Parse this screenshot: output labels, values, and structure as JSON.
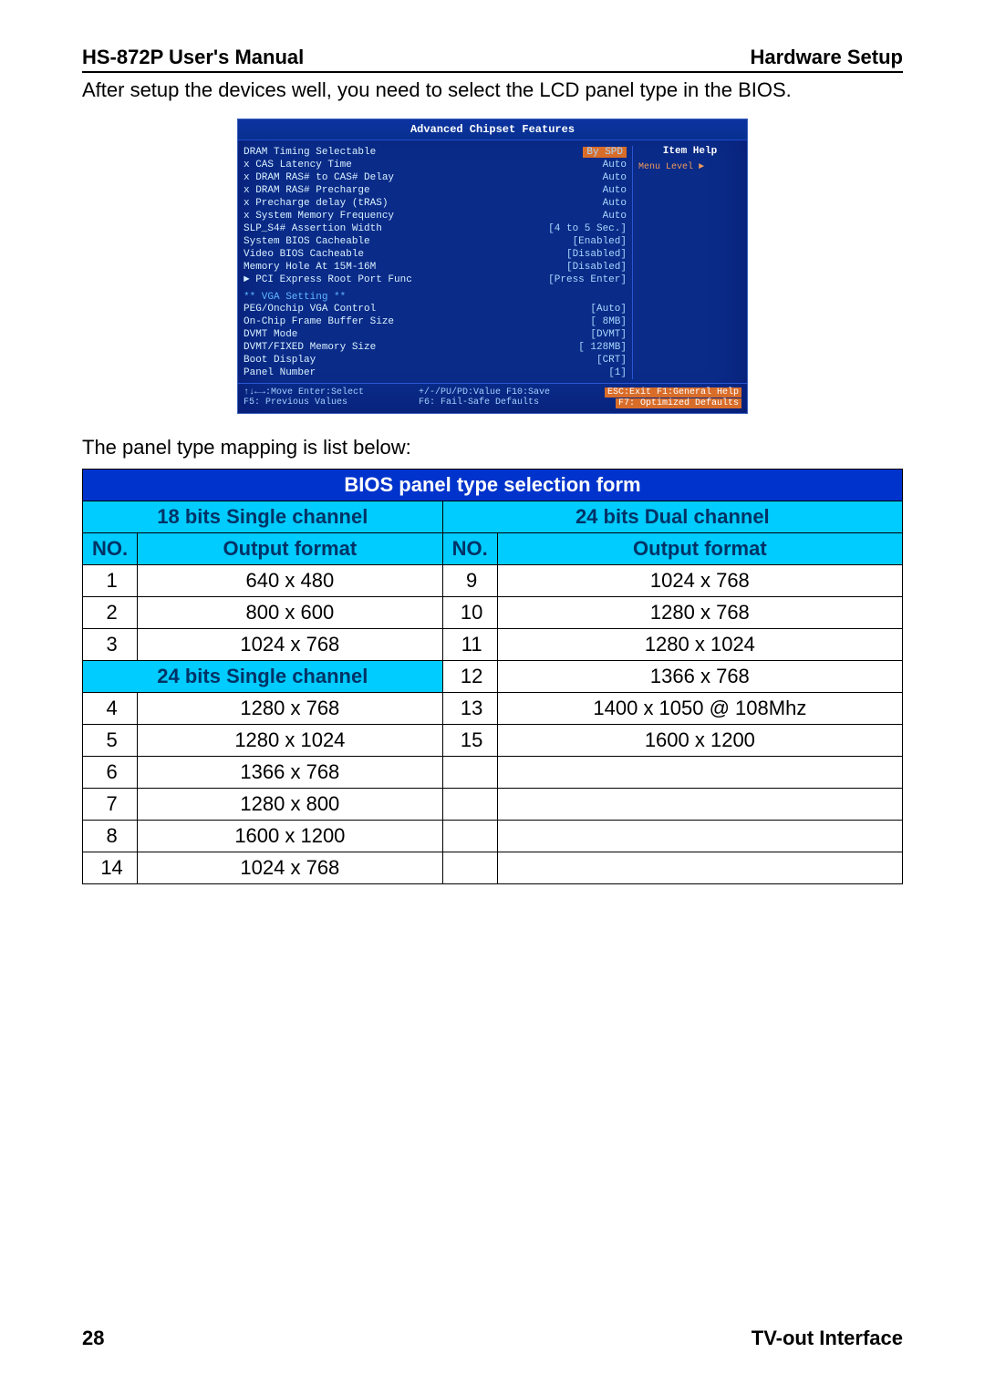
{
  "header": {
    "left": "HS-872P User's Manual",
    "right": "Hardware Setup"
  },
  "intro": "After setup the devices well, you need to select the LCD panel type in the BIOS.",
  "bios": {
    "title": "Advanced Chipset Features",
    "rows": [
      {
        "lbl": "DRAM Timing Selectable",
        "val": "By SPD",
        "hl": true
      },
      {
        "lbl": "x CAS Latency Time",
        "val": "Auto",
        "dim": true
      },
      {
        "lbl": "x DRAM RAS# to CAS# Delay",
        "val": "Auto",
        "dim": true
      },
      {
        "lbl": "x DRAM RAS# Precharge",
        "val": "Auto",
        "dim": true
      },
      {
        "lbl": "x Precharge delay (tRAS)",
        "val": "Auto",
        "dim": true
      },
      {
        "lbl": "x System Memory Frequency",
        "val": "Auto",
        "dim": true
      },
      {
        "lbl": "SLP_S4# Assertion Width",
        "val": "[4 to 5 Sec.]"
      },
      {
        "lbl": "System BIOS Cacheable",
        "val": "[Enabled]"
      },
      {
        "lbl": "Video BIOS Cacheable",
        "val": "[Disabled]"
      },
      {
        "lbl": "Memory Hole At 15M-16M",
        "val": "[Disabled]"
      },
      {
        "lbl": "► PCI Express Root Port Func",
        "val": "[Press Enter]"
      }
    ],
    "sectionHeading": "** VGA Setting **",
    "rows2": [
      {
        "lbl": "PEG/Onchip VGA Control",
        "val": "[Auto]"
      },
      {
        "lbl": "On-Chip Frame Buffer Size",
        "val": "[ 8MB]"
      },
      {
        "lbl": "DVMT Mode",
        "val": "[DVMT]"
      },
      {
        "lbl": "DVMT/FIXED Memory Size",
        "val": "[ 128MB]"
      },
      {
        "lbl": "Boot Display",
        "val": "[CRT]"
      },
      {
        "lbl": "Panel Number",
        "val": "[1]"
      }
    ],
    "help": {
      "title": "Item Help",
      "sub": "Menu Level  ►"
    },
    "footer": {
      "left1": "↑↓←→:Move  Enter:Select",
      "left2": "F5: Previous Values",
      "mid1": "+/-/PU/PD:Value  F10:Save",
      "mid2": "F6: Fail-Safe Defaults",
      "r1": "ESC:Exit  F1:General Help",
      "r2": "F7: Optimized Defaults"
    }
  },
  "caption": "The panel type mapping is list below:",
  "table": {
    "title": "BIOS panel type selection form",
    "h_left": "18 bits Single channel",
    "h_right": "24 bits Dual channel",
    "sub_no": "NO.",
    "sub_fmt": "Output format",
    "left_section2": "24 bits Single channel",
    "left": [
      {
        "no": "1",
        "fmt": "640 x 480"
      },
      {
        "no": "2",
        "fmt": "800 x 600"
      },
      {
        "no": "3",
        "fmt": "1024 x 768"
      }
    ],
    "left2": [
      {
        "no": "4",
        "fmt": "1280 x 768"
      },
      {
        "no": "5",
        "fmt": "1280 x 1024"
      },
      {
        "no": "6",
        "fmt": "1366 x 768"
      },
      {
        "no": "7",
        "fmt": "1280 x 800"
      },
      {
        "no": "8",
        "fmt": "1600 x 1200"
      },
      {
        "no": "14",
        "fmt": "1024 x 768"
      }
    ],
    "right": [
      {
        "no": "9",
        "fmt": "1024 x 768"
      },
      {
        "no": "10",
        "fmt": "1280 x 768"
      },
      {
        "no": "11",
        "fmt": "1280 x 1024"
      },
      {
        "no": "12",
        "fmt": "1366 x 768"
      },
      {
        "no": "13",
        "fmt": "1400 x 1050 @ 108Mhz"
      },
      {
        "no": "15",
        "fmt": "1600 x 1200"
      },
      {
        "no": "",
        "fmt": ""
      },
      {
        "no": "",
        "fmt": ""
      },
      {
        "no": "",
        "fmt": ""
      }
    ]
  },
  "footer": {
    "page": "28",
    "section": "TV-out  Interface"
  }
}
